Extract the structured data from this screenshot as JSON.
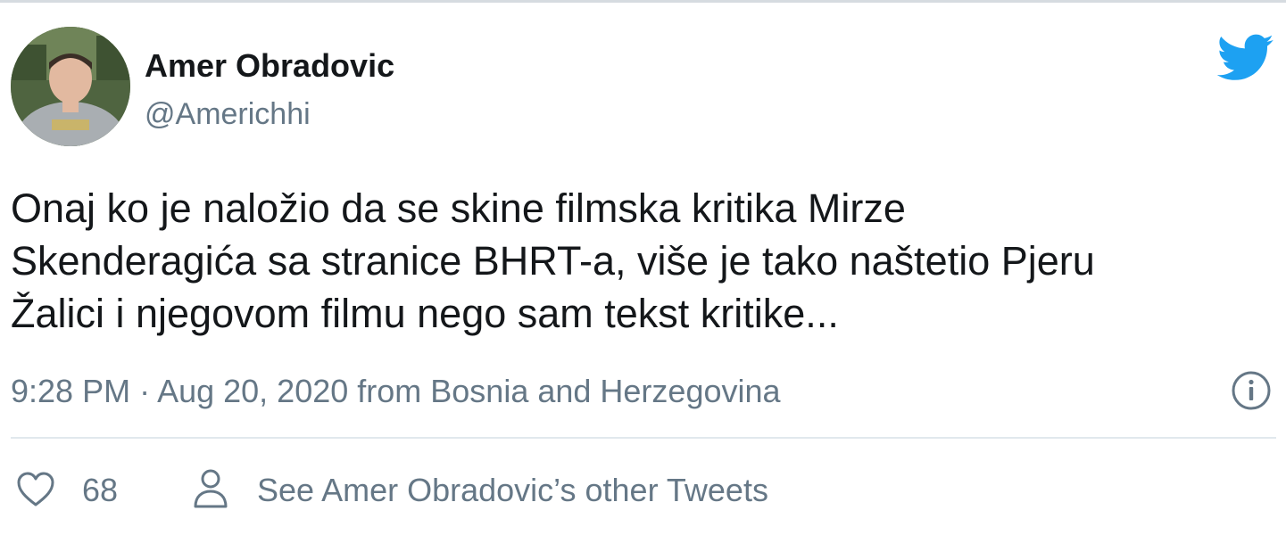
{
  "tweet": {
    "author": {
      "display_name": "Amer Obradovic",
      "handle": "@Americhhi",
      "avatar_icon": "user-avatar-photo"
    },
    "logo_icon": "twitter-bird-icon",
    "text_lines": [
      "Onaj ko je naložio da se skine filmska kritika Mirze",
      "Skenderagića sa stranice BHRT-a, više je tako naštetio Pjeru",
      "Žalici i njegovom filmu nego sam tekst kritike..."
    ],
    "meta": "9:28 PM · Aug 20, 2020 from Bosnia and Herzegovina",
    "info_icon": "info-icon",
    "actions": {
      "like_icon": "heart-icon",
      "like_count": "68",
      "profile_icon": "person-icon",
      "other_tweets_label": "See Amer Obradovic’s other Tweets"
    }
  },
  "colors": {
    "text_primary": "#14171a",
    "text_secondary": "#657786",
    "twitter_blue": "#1da1f2",
    "divider": "#e1e8ed"
  }
}
